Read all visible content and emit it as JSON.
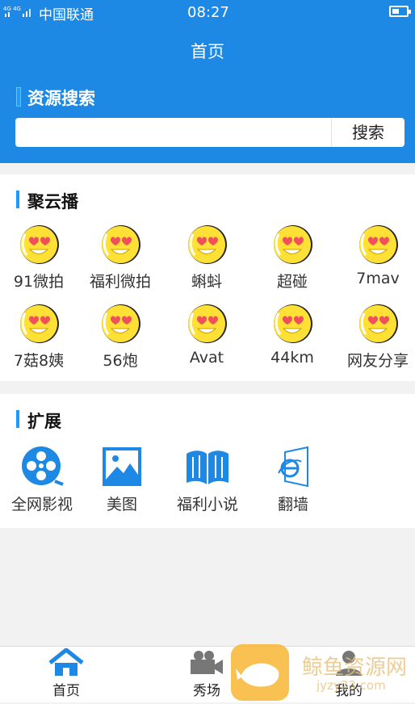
{
  "status": {
    "carrier": "中国联通",
    "time": "08:27",
    "network": "4G 4G"
  },
  "header": {
    "title": "首页",
    "section": "资源搜索"
  },
  "search": {
    "value": "",
    "button": "搜索"
  },
  "juyunbo": {
    "title": "聚云播",
    "items": [
      "91微拍",
      "福利微拍",
      "蝌蚪",
      "超碰",
      "7mav",
      "7菇8姨",
      "56炮",
      "Avat",
      "44km",
      "网友分享"
    ]
  },
  "extend": {
    "title": "扩展",
    "items": [
      {
        "label": "全网影视",
        "icon": "film-reel-icon"
      },
      {
        "label": "美图",
        "icon": "picture-icon"
      },
      {
        "label": "福利小说",
        "icon": "open-book-icon"
      },
      {
        "label": "翻墙",
        "icon": "ie-browser-icon"
      }
    ]
  },
  "tabs": [
    {
      "label": "首页",
      "icon": "home-icon",
      "color": "#1e88e5"
    },
    {
      "label": "秀场",
      "icon": "video-camera-icon"
    },
    {
      "label": "我的",
      "icon": "user-icon"
    }
  ],
  "watermark": {
    "title": "鲸鱼资源网",
    "url": "jyzy23.com"
  },
  "colors": {
    "primary": "#1e88e5",
    "accent": "#1e9bff",
    "emoji": "#ffe135"
  }
}
